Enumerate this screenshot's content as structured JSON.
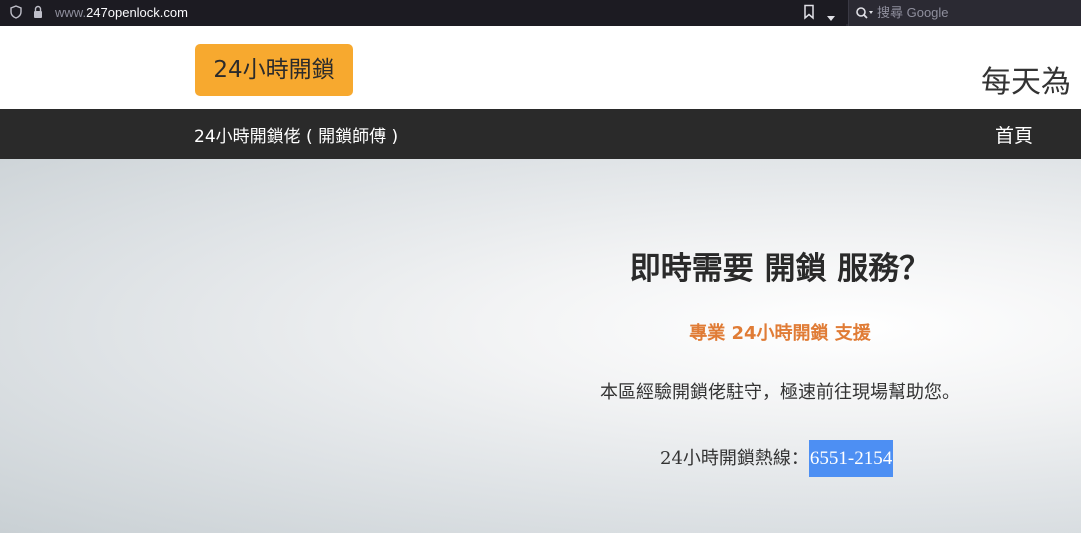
{
  "browser": {
    "url_prefix": "www.",
    "url_domain": "247openlock.com",
    "search_placeholder": "搜尋 Google",
    "icons": [
      "shield-icon",
      "lock-icon",
      "bookmark-icon",
      "chevron-down-icon",
      "search-icon"
    ]
  },
  "header": {
    "logo_label": "24小時開鎖",
    "slogan": "每天為"
  },
  "nav": {
    "brand": "24小時開鎖佬 ( 開鎖師傅 )",
    "home": "首頁"
  },
  "hero": {
    "title": "即時需要 開鎖 服務？",
    "subtitle": "專業 24小時開鎖 支援",
    "description": "本區經驗開鎖佬駐守，極速前往現場幫助您。",
    "hotline_label": "24小時開鎖熱線：",
    "hotline_number": "6551-2154"
  },
  "colors": {
    "logo_bg": "#f7a92f",
    "nav_bg": "#2a2a2a",
    "accent_orange": "#e07c36",
    "selection_blue": "#4d8ff3"
  }
}
